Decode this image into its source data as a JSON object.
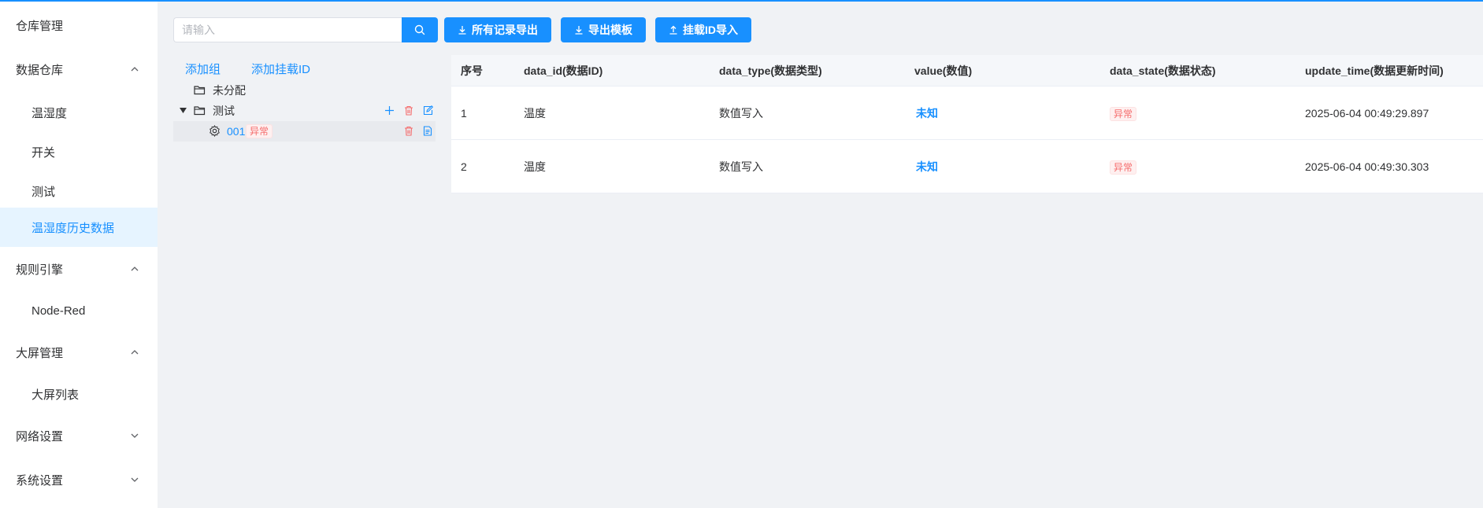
{
  "sidebar": {
    "items": [
      {
        "label": "仓库管理"
      },
      {
        "label": "数据仓库"
      },
      {
        "label": "温湿度"
      },
      {
        "label": "开关"
      },
      {
        "label": "测试"
      },
      {
        "label": "温湿度历史数据"
      },
      {
        "label": "规则引擎"
      },
      {
        "label": "Node-Red"
      },
      {
        "label": "大屏管理"
      },
      {
        "label": "大屏列表"
      },
      {
        "label": "网络设置"
      },
      {
        "label": "系统设置"
      }
    ],
    "active": "温湿度历史数据"
  },
  "toolbar": {
    "search_placeholder": "请输入",
    "search_value": "",
    "export_all_label": "所有记录导出",
    "export_template_label": "导出模板",
    "import_label": "挂载ID导入"
  },
  "tree": {
    "add_group_label": "添加组",
    "add_mount_label": "添加挂载ID",
    "nodes": [
      {
        "label": "未分配"
      },
      {
        "label": "测试"
      },
      {
        "label": "001",
        "tag": "异常"
      }
    ]
  },
  "table": {
    "headers": [
      "序号",
      "data_id(数据ID)",
      "data_type(数据类型)",
      "value(数值)",
      "data_state(数据状态)",
      "update_time(数据更新时间)"
    ],
    "rows": [
      {
        "index": "1",
        "data_id": "温度",
        "data_type": "数值写入",
        "value": "未知",
        "state": "异常",
        "time": "2025-06-04 00:49:29.897"
      },
      {
        "index": "2",
        "data_id": "温度",
        "data_type": "数值写入",
        "value": "未知",
        "state": "异常",
        "time": "2025-06-04 00:49:30.303"
      }
    ]
  },
  "colors": {
    "accent": "#1890ff",
    "danger": "#f56c6c",
    "active_bg": "#e6f4ff",
    "background": "#f0f2f5"
  }
}
